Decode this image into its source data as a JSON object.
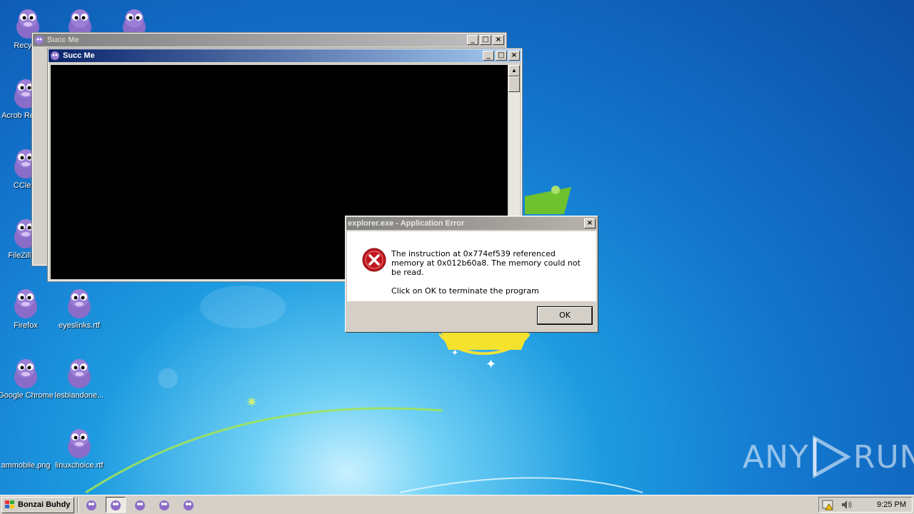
{
  "desktop": {
    "icons": [
      {
        "label": "Recycle"
      },
      {
        "label": "Acrob Reader"
      },
      {
        "label": "CClear"
      },
      {
        "label": "FileZilla C"
      },
      {
        "label": "Firefox"
      },
      {
        "label": "eyeslinks.rtf"
      },
      {
        "label": "Google Chrome"
      },
      {
        "label": "lesbiandone..."
      },
      {
        "label": "ammobile.png"
      },
      {
        "label": "linuxchoice.rtf"
      }
    ]
  },
  "window_back": {
    "title": "Succ Me"
  },
  "window_front": {
    "title": "Succ Me"
  },
  "error_dialog": {
    "title": "explorer.exe - Application Error",
    "line1": "The instruction at 0x774ef539 referenced memory at 0x012b60a8. The memory could not be read.",
    "line2": "Click on OK to terminate the program",
    "ok_label": "OK"
  },
  "taskbar": {
    "start_label": "Bonzai Buhdy",
    "clock": "9:25 PM"
  },
  "watermark": {
    "left": "ANY",
    "right": "RUN"
  },
  "colors": {
    "title_active": "#0a246a",
    "title_inactive": "#808080",
    "error_red": "#c0161c"
  }
}
